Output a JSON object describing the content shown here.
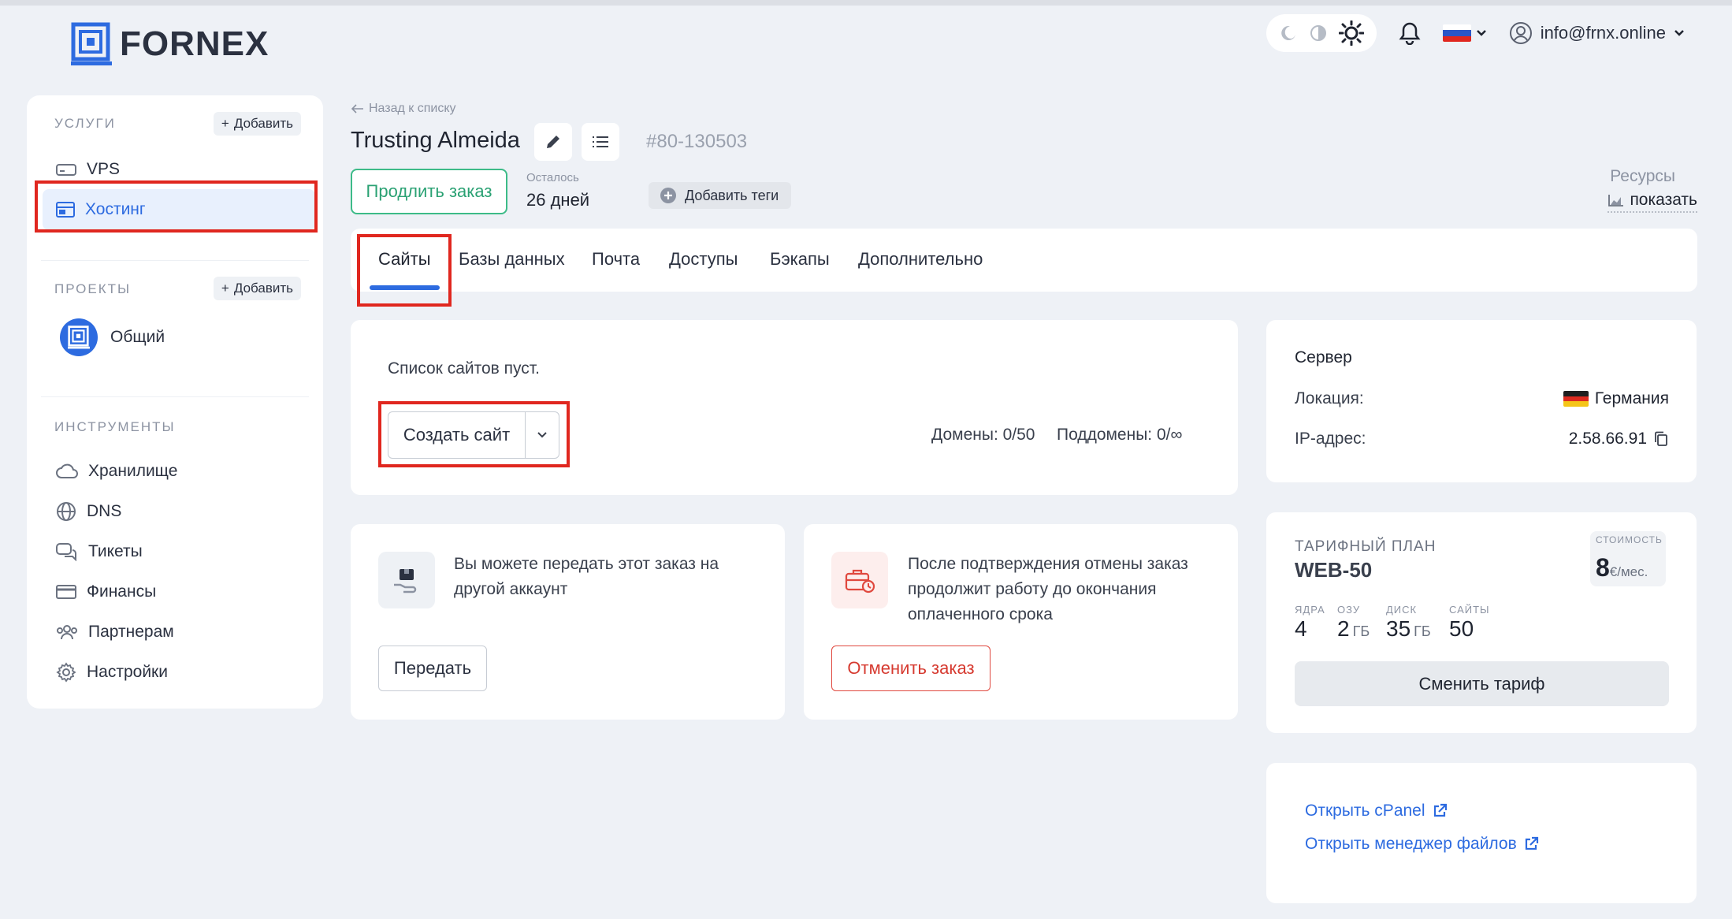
{
  "brand": {
    "name": "FORNEX",
    "color": "#2d6be0"
  },
  "header": {
    "theme_icons": [
      "moon-icon",
      "auto-theme-icon",
      "sun-icon"
    ],
    "notifications_icon": "bell-icon",
    "language_flag": "ru",
    "user_email": "info@frnx.online"
  },
  "sidebar": {
    "services": {
      "title": "УСЛУГИ",
      "add_label": "Добавить",
      "items": [
        {
          "label": "VPS",
          "icon": "server-icon"
        },
        {
          "label": "Хостинг",
          "icon": "browser-window-icon",
          "active": true
        }
      ]
    },
    "projects": {
      "title": "ПРОЕКТЫ",
      "add_label": "Добавить",
      "items": [
        {
          "label": "Общий",
          "icon": "project-logo-icon"
        }
      ]
    },
    "tools": {
      "title": "ИНСТРУМЕНТЫ",
      "items": [
        {
          "label": "Хранилище",
          "icon": "cloud-icon"
        },
        {
          "label": "DNS",
          "icon": "globe-icon"
        },
        {
          "label": "Тикеты",
          "icon": "chat-icon"
        },
        {
          "label": "Финансы",
          "icon": "credit-card-icon"
        },
        {
          "label": "Партнерам",
          "icon": "users-icon"
        },
        {
          "label": "Настройки",
          "icon": "gear-icon"
        }
      ]
    }
  },
  "order": {
    "back_label": "Назад к списку",
    "title": "Trusting Almeida",
    "id": "80-130503",
    "renew_label": "Продлить заказ",
    "remaining_label": "Осталось",
    "remaining_value": "26 дней",
    "add_tags_label": "Добавить теги",
    "resources_label": "Ресурсы",
    "resources_link": "показать"
  },
  "tabs": [
    {
      "label": "Сайты",
      "active": true
    },
    {
      "label": "Базы данных"
    },
    {
      "label": "Почта"
    },
    {
      "label": "Доступы"
    },
    {
      "label": "Бэкапы"
    },
    {
      "label": "Дополнительно"
    }
  ],
  "sites": {
    "empty_text": "Список сайтов пуст.",
    "create_label": "Создать сайт",
    "domains_text": "Домены: 0/50",
    "subdomains_text": "Поддомены: 0/∞"
  },
  "transfer": {
    "text_line1": "Вы можете передать этот заказ на",
    "text_line2": "другой аккаунт",
    "button_label": "Передать"
  },
  "cancel": {
    "text_line1": "После подтверждения отмены заказ",
    "text_line2": "продолжит работу до окончания",
    "text_line3": "оплаченного срока",
    "button_label": "Отменить заказ",
    "accent": "#e0483e"
  },
  "server": {
    "title": "Сервер",
    "location_label": "Локация:",
    "location_value": "Германия",
    "ip_label": "IP-адрес:",
    "ip_value": "2.58.66.91"
  },
  "plan": {
    "label": "ТАРИФНЫЙ ПЛАН",
    "name": "WEB-50",
    "price_label": "СТОИМОСТЬ",
    "price_value": "8",
    "price_unit": "€/мес.",
    "specs": [
      {
        "label": "ЯДРА",
        "value": "4",
        "unit": ""
      },
      {
        "label": "ОЗУ",
        "value": "2",
        "unit": "ГБ"
      },
      {
        "label": "ДИСК",
        "value": "35",
        "unit": "ГБ"
      },
      {
        "label": "САЙТЫ",
        "value": "50",
        "unit": ""
      }
    ],
    "change_label": "Сменить тариф"
  },
  "links": {
    "cpanel": "Открыть cPanel",
    "file_manager": "Открыть менеджер файлов"
  }
}
